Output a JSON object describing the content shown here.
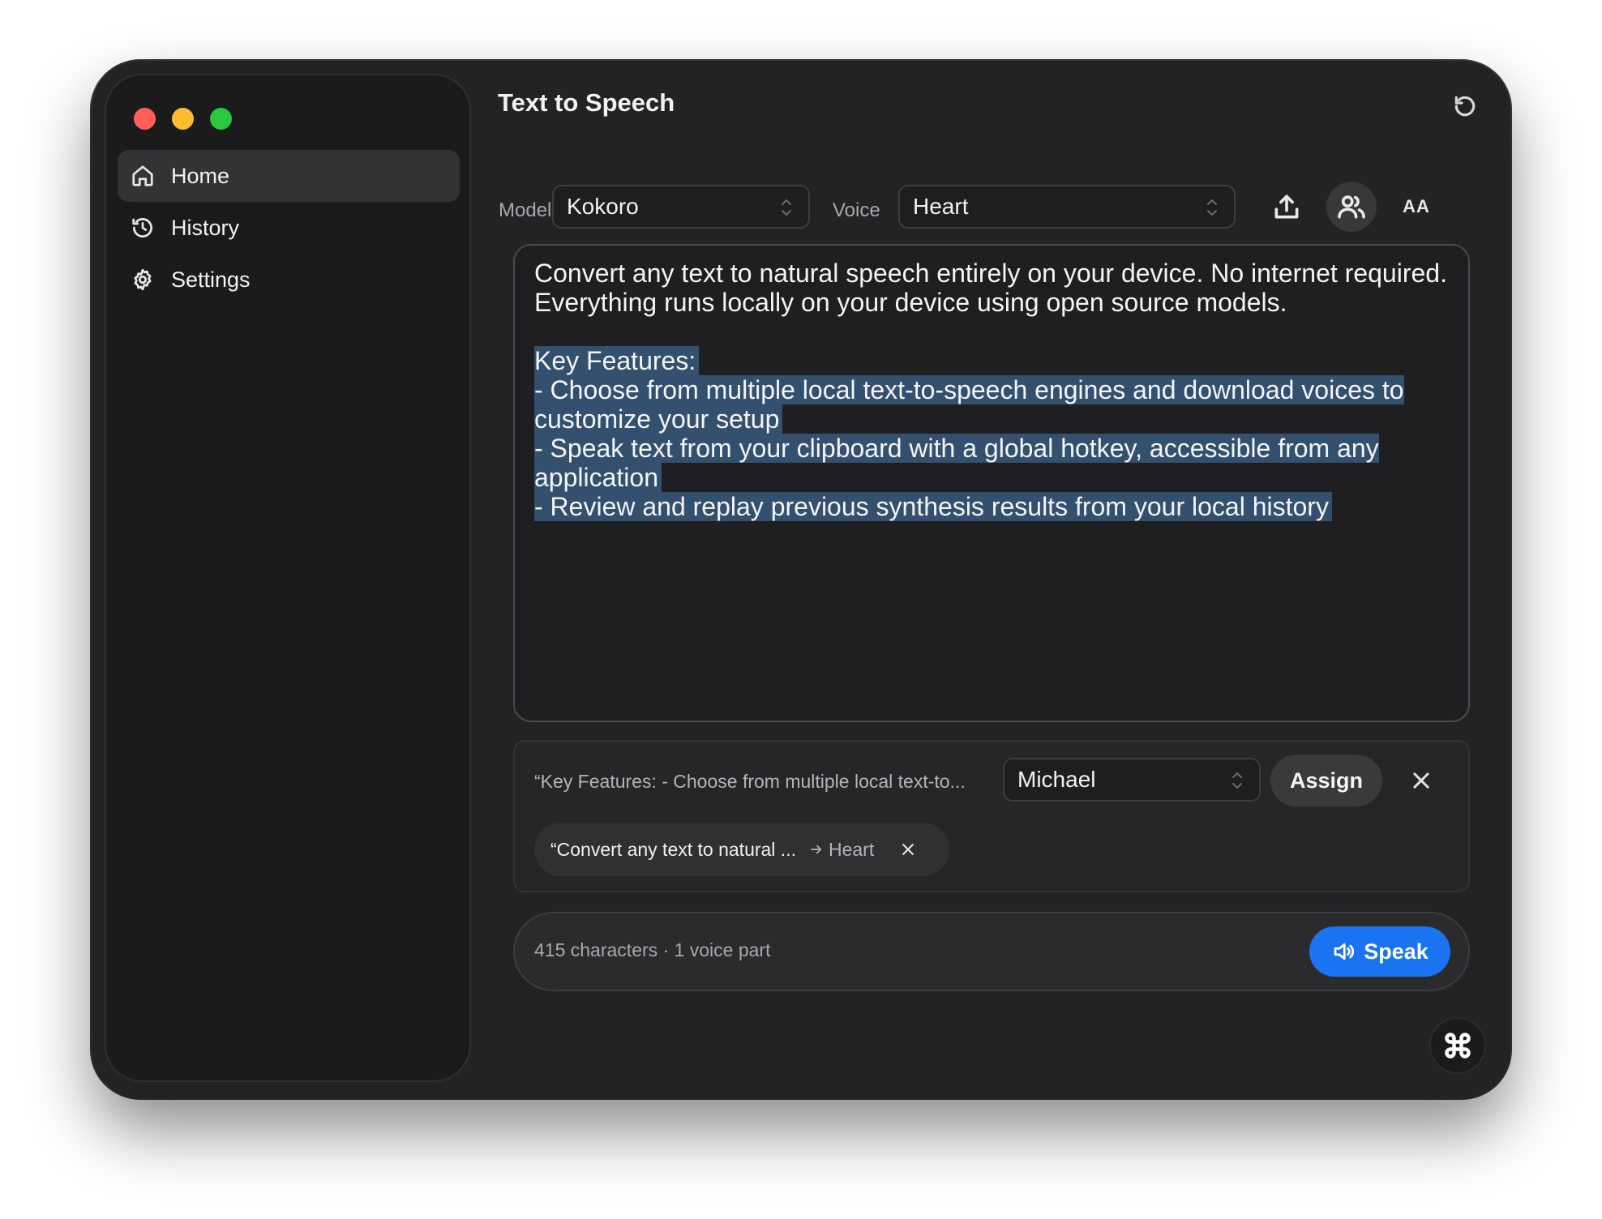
{
  "window": {
    "title": "Text to Speech"
  },
  "sidebar": {
    "items": [
      {
        "label": "Home",
        "icon": "home-icon",
        "active": true
      },
      {
        "label": "History",
        "icon": "history-icon",
        "active": false
      },
      {
        "label": "Settings",
        "icon": "gear-icon",
        "active": false
      }
    ]
  },
  "toolbar": {
    "model_label": "Model",
    "model_value": "Kokoro",
    "voice_label": "Voice",
    "voice_value": "Heart",
    "font_size_label": "AA"
  },
  "editor": {
    "intro": "Convert any text to natural speech entirely on your device. No internet required. Everything runs locally on your device using open source models.",
    "selected_lines": [
      "Key Features:",
      "- Choose from multiple local text-to-speech engines and download voices to customize your setup",
      "- Speak text from your clipboard with a global hotkey, accessible from any application",
      "- Review and replay previous synthesis results from your local history"
    ]
  },
  "assign_panel": {
    "selection_snippet": "“Key Features: - Choose from multiple local text-to...",
    "voice_value": "Michael",
    "assign_label": "Assign",
    "assignments": [
      {
        "text": "“Convert any text to natural ...",
        "voice": "Heart"
      }
    ]
  },
  "footer": {
    "summary": "415 characters · 1 voice part",
    "speak_label": "Speak"
  },
  "colors": {
    "accent": "#1a73f0",
    "selection": "#34506f",
    "background": "#232325"
  }
}
